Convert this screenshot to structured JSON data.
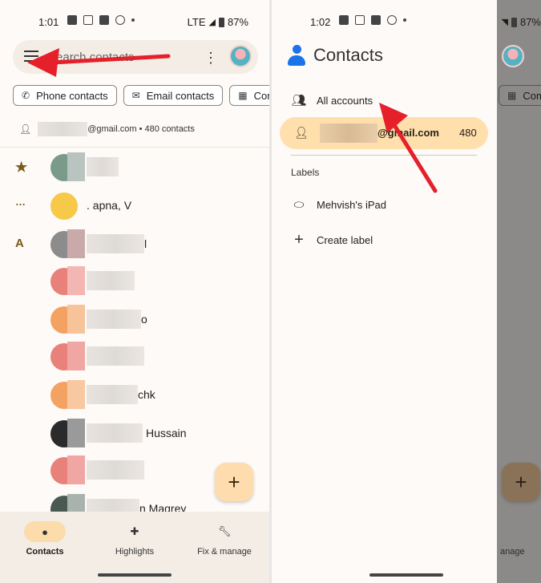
{
  "left": {
    "status": {
      "time": "1:01",
      "network": "LTE",
      "battery": "87%"
    },
    "search": {
      "placeholder": "Search contacts"
    },
    "chips": [
      {
        "label": "Phone contacts",
        "icon": "phone-icon"
      },
      {
        "label": "Email contacts",
        "icon": "mail-icon"
      },
      {
        "label": "Com",
        "icon": "building-icon"
      }
    ],
    "account": {
      "email": "@gmail.com • 480 contacts"
    },
    "sections": {
      "starred_icon": "★",
      "more_icon": "…",
      "letter_a": "A"
    },
    "contacts": [
      {
        "name": ""
      },
      {
        "name": ". apna, V"
      },
      {
        "name": "l"
      },
      {
        "name": ""
      },
      {
        "name": "o"
      },
      {
        "name": ""
      },
      {
        "name": "chk"
      },
      {
        "name": "Hussain"
      },
      {
        "name": ""
      },
      {
        "name": "n Magrey"
      }
    ],
    "fab": "+",
    "nav": [
      {
        "label": "Contacts",
        "icon": "person-icon"
      },
      {
        "label": "Highlights",
        "icon": "sparkle-icon"
      },
      {
        "label": "Fix & manage",
        "icon": "wrench-icon"
      }
    ]
  },
  "right": {
    "status": {
      "time": "1:02",
      "battery": "87%"
    },
    "drawer": {
      "title": "Contacts",
      "all_accounts": "All accounts",
      "selected": {
        "email": "@gmail.com",
        "count": "480"
      },
      "labels_header": "Labels",
      "label_item": "Mehvish's iPad",
      "create_label": "Create label"
    },
    "scrim": {
      "chip": "Com",
      "nav_label": "anage",
      "fab": "+"
    }
  },
  "colors": {
    "accent": "#ffdcad",
    "arrow": "#e5202b",
    "brand_blue": "#1a73e8"
  }
}
